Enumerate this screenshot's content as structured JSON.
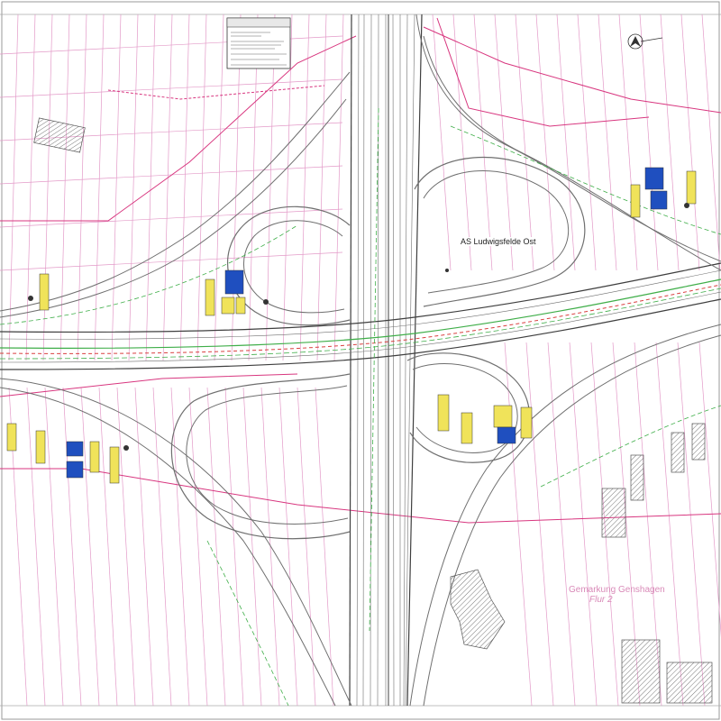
{
  "map": {
    "interchange_label": "AS Ludwigsfelde Ost",
    "parcel_district_label": "Gemarkung Genshagen",
    "parcel_sheet_label": "Flur 2"
  },
  "colors": {
    "background": "#ffffff",
    "parcel_line": "#e39ac8",
    "boundary_line": "#d8367f",
    "road_line": "#6f6f6f",
    "road_dark": "#3f3f3f",
    "centerline_green": "#3fae49",
    "centerline_red": "#d93f3f",
    "sign_blue": "#1f4fbf",
    "sign_yellow": "#f0e35a"
  },
  "icons": {
    "north_arrow": "north-arrow-icon",
    "survey_marker": "survey-marker-icon"
  }
}
